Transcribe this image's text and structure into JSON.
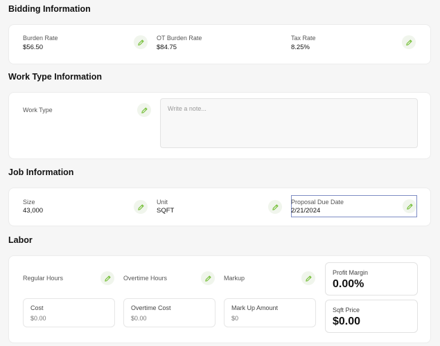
{
  "bidding": {
    "title": "Bidding Information",
    "fields": [
      {
        "label": "Burden Rate",
        "value": "$56.50"
      },
      {
        "label": "OT Burden Rate",
        "value": "$84.75"
      },
      {
        "label": "Tax Rate",
        "value": "8.25%"
      }
    ]
  },
  "work_type": {
    "title": "Work Type Information",
    "label": "Work Type",
    "note_placeholder": "Write a note..."
  },
  "job": {
    "title": "Job Information",
    "fields": [
      {
        "label": "Size",
        "value": "43,000"
      },
      {
        "label": "Unit",
        "value": "SQFT"
      },
      {
        "label": "Proposal Due Date",
        "value": "2/21/2024"
      }
    ]
  },
  "labor": {
    "title": "Labor",
    "inputs": [
      {
        "label": "Regular Hours"
      },
      {
        "label": "Overtime Hours"
      },
      {
        "label": "Markup"
      }
    ],
    "costs": [
      {
        "label": "Cost",
        "value": "$0.00"
      },
      {
        "label": "Overtime Cost",
        "value": "$0.00"
      },
      {
        "label": "Mark Up Amount",
        "value": "$0"
      }
    ],
    "profit_margin": {
      "label": "Profit Margin",
      "value": "0.00%"
    },
    "sqft_price": {
      "label": "Sqft Price",
      "value": "$0.00"
    }
  },
  "colors": {
    "accent": "#7cc242",
    "icon_bg": "#f0f5ec"
  },
  "icons": {
    "edit": "pencil-icon"
  }
}
